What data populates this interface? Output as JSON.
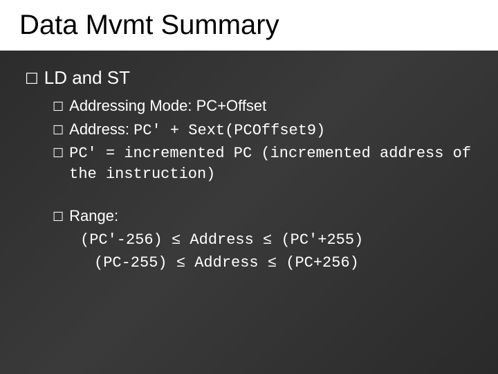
{
  "title": "Data Mvmt Summary",
  "main_bullet": "LD and ST",
  "sub": {
    "addr_mode_label": "Addressing Mode: ",
    "addr_mode_value": "PC+Offset",
    "address_label": "Address: ",
    "address_value": "PC' + Sext(PCOffset9)",
    "pc_note": "PC' = incremented PC (incremented address of the instruction)",
    "range_label": "Range:"
  },
  "range": {
    "line1": "(PC'-256) ≤ Address ≤ (PC'+255)",
    "line2": "(PC-255) ≤ Address ≤ (PC+256)"
  }
}
